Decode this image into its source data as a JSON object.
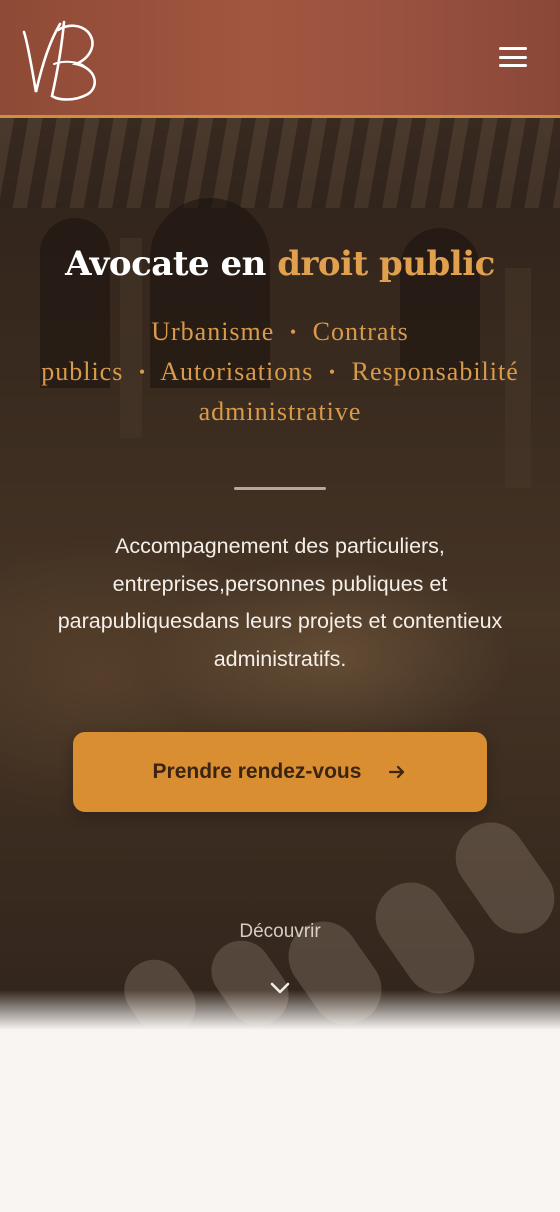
{
  "header": {
    "logo_text": "VB",
    "menu_icon": "hamburger-menu-icon"
  },
  "hero": {
    "title_prefix": "Avocate en",
    "title_accent": "droit public",
    "specialties_line1_a": "Urbanisme",
    "specialties_line1_b": "Contrats",
    "specialties_line2_a": "publics",
    "specialties_line2_b": "Autorisations",
    "specialties_line2_c": "Responsabilité",
    "specialties_line3": "administrative",
    "separator": "•",
    "description_line1": "Accompagnement des particuliers,",
    "description_line2": "entreprises,personnes publiques et",
    "description_line3": "parapubliquesdans leurs projets et contentieux",
    "description_line4": "administratifs.",
    "cta_label": "Prendre rendez-vous",
    "cta_icon": "arrow-right-icon",
    "discover_label": "Découvrir",
    "discover_icon": "chevron-down-icon"
  },
  "colors": {
    "header_bg": "#9a5240",
    "accent": "#d88e31",
    "accent_text": "#e0a04e",
    "page_bg": "#f8f5f2"
  }
}
